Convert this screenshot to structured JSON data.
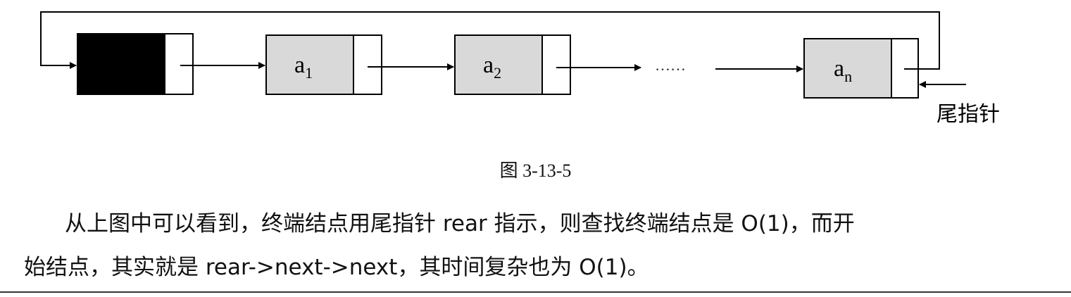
{
  "diagram": {
    "nodes": [
      {
        "label": "",
        "sub": "",
        "head": true
      },
      {
        "label": "a",
        "sub": "1",
        "head": false
      },
      {
        "label": "a",
        "sub": "2",
        "head": false
      },
      {
        "label": "a",
        "sub": "n",
        "head": false
      }
    ],
    "ellipsis": "……",
    "tail_pointer_label": "尾指针",
    "colors": {
      "head_fill": "#000000",
      "node_fill": "#d9d9d9",
      "stroke": "#000000"
    }
  },
  "caption": "图 3-13-5",
  "paragraph": {
    "line1": "从上图中可以看到，终端结点用尾指针 rear 指示，则查找终端结点是 O(1)，而开",
    "line2": "始结点，其实就是 rear->next->next，其时间复杂也为 O(1)。"
  }
}
